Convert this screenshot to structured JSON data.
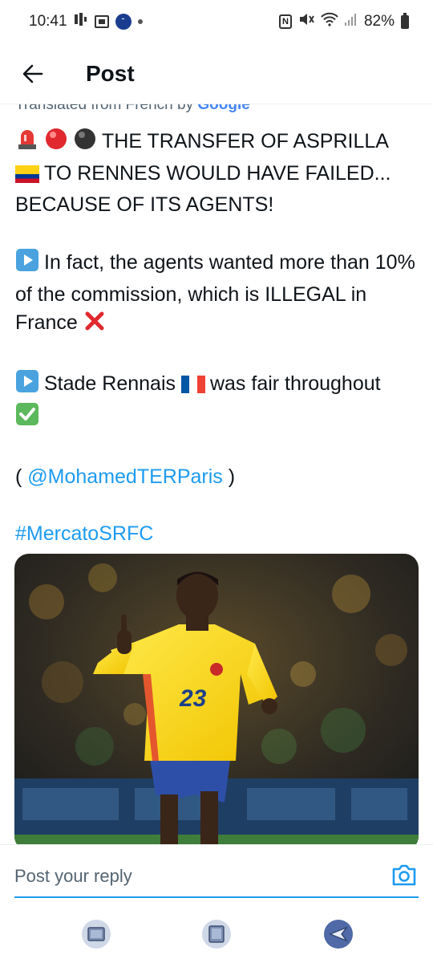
{
  "status": {
    "time": "10:41",
    "battery": "82%"
  },
  "header": {
    "title": "Post"
  },
  "post": {
    "translated_prefix": "Translated from French by ",
    "translated_brand": "Google",
    "line1": "THE TRANSFER OF ASPRILLA",
    "line2": "TO RENNES WOULD HAVE FAILED...",
    "line3": "BECAUSE OF ITS AGENTS!",
    "para2": "In fact, the agents wanted more than 10% of the commission, which is ILLEGAL in France",
    "para3_a": "Stade Rennais",
    "para3_b": "was fair throughout",
    "credit_open": "(",
    "credit_handle": "@MohamedTERParis",
    "credit_close": ")",
    "hashtag": "#MercatoSRFC",
    "media": {
      "jersey_number": "23"
    }
  },
  "reply": {
    "placeholder": "Post your reply"
  },
  "icons": {
    "back": "arrow-left-icon",
    "camera": "camera-icon",
    "siren": "rotating-light-emoji",
    "play": "play-button-emoji",
    "cross": "cross-mark-emoji",
    "check": "check-mark-emoji"
  },
  "colors": {
    "accent": "#1d9bf0",
    "text": "#0f1419",
    "muted": "#536471"
  }
}
